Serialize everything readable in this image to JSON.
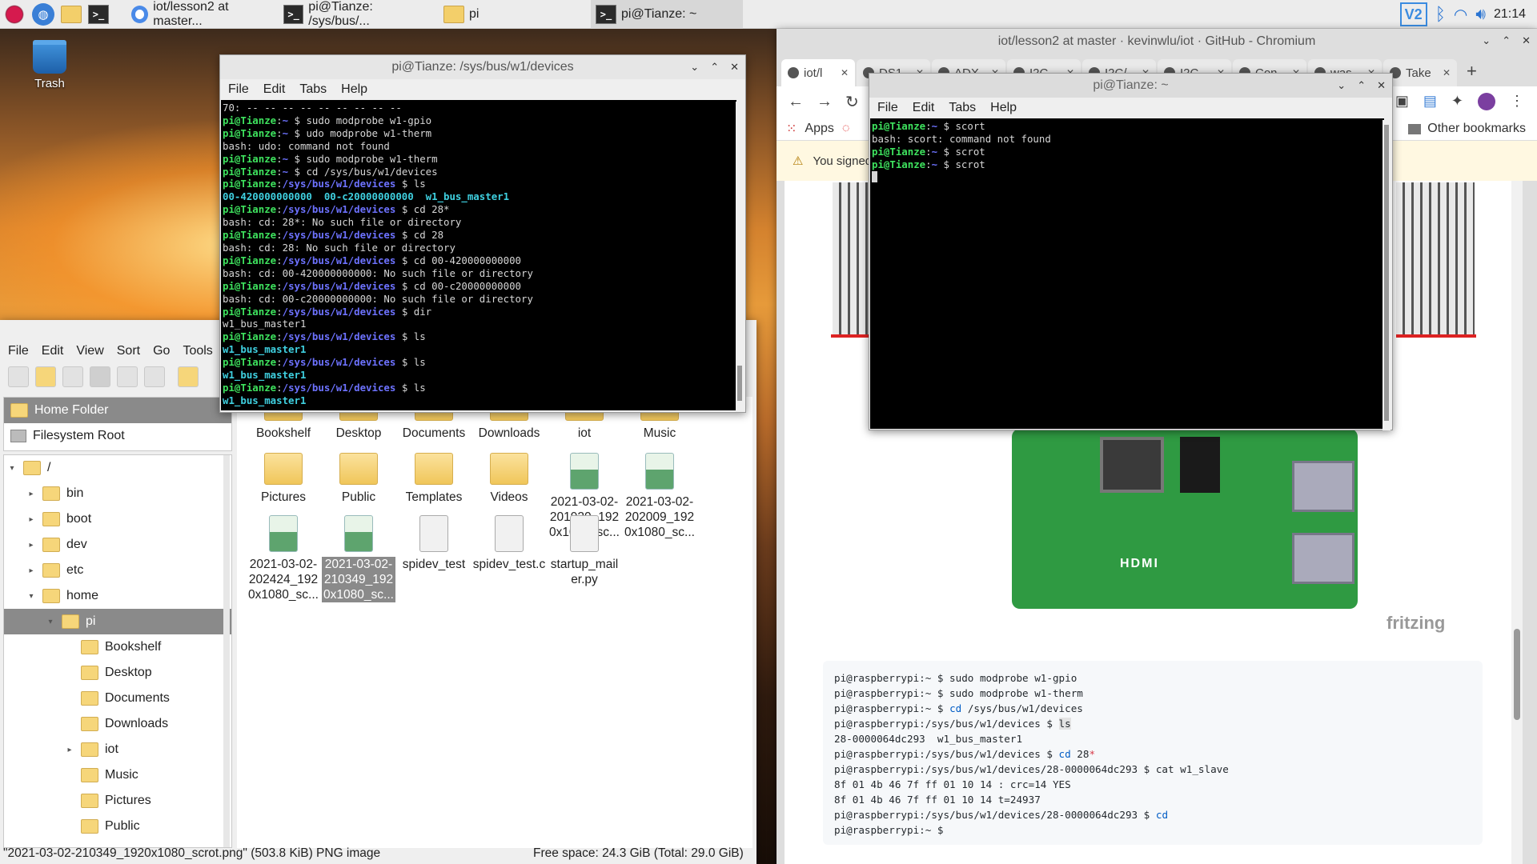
{
  "panel": {
    "tasks": [
      {
        "label": "iot/lesson2 at master..."
      },
      {
        "label": "pi@Tianze: /sys/bus/..."
      },
      {
        "label": "pi"
      },
      {
        "label": "pi@Tianze: ~"
      }
    ],
    "clock": "21:14",
    "vnc_label": "V2"
  },
  "desktop": {
    "trash_label": "Trash"
  },
  "term1": {
    "title": "pi@Tianze: /sys/bus/w1/devices",
    "menu": [
      "File",
      "Edit",
      "Tabs",
      "Help"
    ],
    "lines": [
      [
        [
          "w",
          "70: -- -- -- -- -- -- -- -- --"
        ]
      ],
      [
        [
          "g",
          "pi@Tianze"
        ],
        [
          "w",
          ":"
        ],
        [
          "b",
          "~"
        ],
        [
          "w",
          " $ sudo modprobe w1-gpio"
        ]
      ],
      [
        [
          "g",
          "pi@Tianze"
        ],
        [
          "w",
          ":"
        ],
        [
          "b",
          "~"
        ],
        [
          "w",
          " $ udo modprobe w1-therm"
        ]
      ],
      [
        [
          "w",
          "bash: udo: command not found"
        ]
      ],
      [
        [
          "g",
          "pi@Tianze"
        ],
        [
          "w",
          ":"
        ],
        [
          "b",
          "~"
        ],
        [
          "w",
          " $ sudo modprobe w1-therm"
        ]
      ],
      [
        [
          "g",
          "pi@Tianze"
        ],
        [
          "w",
          ":"
        ],
        [
          "b",
          "~"
        ],
        [
          "w",
          " $ cd /sys/bus/w1/devices"
        ]
      ],
      [
        [
          "g",
          "pi@Tianze"
        ],
        [
          "w",
          ":"
        ],
        [
          "b",
          "/sys/bus/w1/devices"
        ],
        [
          "w",
          " $ ls"
        ]
      ],
      [
        [
          "c",
          "00-420000000000  00-c20000000000  w1_bus_master1"
        ]
      ],
      [
        [
          "g",
          "pi@Tianze"
        ],
        [
          "w",
          ":"
        ],
        [
          "b",
          "/sys/bus/w1/devices"
        ],
        [
          "w",
          " $ cd 28*"
        ]
      ],
      [
        [
          "w",
          "bash: cd: 28*: No such file or directory"
        ]
      ],
      [
        [
          "g",
          "pi@Tianze"
        ],
        [
          "w",
          ":"
        ],
        [
          "b",
          "/sys/bus/w1/devices"
        ],
        [
          "w",
          " $ cd 28"
        ]
      ],
      [
        [
          "w",
          "bash: cd: 28: No such file or directory"
        ]
      ],
      [
        [
          "g",
          "pi@Tianze"
        ],
        [
          "w",
          ":"
        ],
        [
          "b",
          "/sys/bus/w1/devices"
        ],
        [
          "w",
          " $ cd 00-420000000000"
        ]
      ],
      [
        [
          "w",
          "bash: cd: 00-420000000000: No such file or directory"
        ]
      ],
      [
        [
          "g",
          "pi@Tianze"
        ],
        [
          "w",
          ":"
        ],
        [
          "b",
          "/sys/bus/w1/devices"
        ],
        [
          "w",
          " $ cd 00-c20000000000"
        ]
      ],
      [
        [
          "w",
          "bash: cd: 00-c20000000000: No such file or directory"
        ]
      ],
      [
        [
          "g",
          "pi@Tianze"
        ],
        [
          "w",
          ":"
        ],
        [
          "b",
          "/sys/bus/w1/devices"
        ],
        [
          "w",
          " $ dir"
        ]
      ],
      [
        [
          "w",
          "w1_bus_master1"
        ]
      ],
      [
        [
          "g",
          "pi@Tianze"
        ],
        [
          "w",
          ":"
        ],
        [
          "b",
          "/sys/bus/w1/devices"
        ],
        [
          "w",
          " $ ls"
        ]
      ],
      [
        [
          "c",
          "w1_bus_master1"
        ]
      ],
      [
        [
          "g",
          "pi@Tianze"
        ],
        [
          "w",
          ":"
        ],
        [
          "b",
          "/sys/bus/w1/devices"
        ],
        [
          "w",
          " $ ls"
        ]
      ],
      [
        [
          "c",
          "w1_bus_master1"
        ]
      ],
      [
        [
          "g",
          "pi@Tianze"
        ],
        [
          "w",
          ":"
        ],
        [
          "b",
          "/sys/bus/w1/devices"
        ],
        [
          "w",
          " $ ls"
        ]
      ],
      [
        [
          "c",
          "w1_bus_master1"
        ]
      ]
    ]
  },
  "term2": {
    "title": "pi@Tianze: ~",
    "menu": [
      "File",
      "Edit",
      "Tabs",
      "Help"
    ],
    "lines": [
      [
        [
          "g",
          "pi@Tianze"
        ],
        [
          "w",
          ":"
        ],
        [
          "b",
          "~"
        ],
        [
          "w",
          " $ scort"
        ]
      ],
      [
        [
          "w",
          "bash: scort: command not found"
        ]
      ],
      [
        [
          "g",
          "pi@Tianze"
        ],
        [
          "w",
          ":"
        ],
        [
          "b",
          "~"
        ],
        [
          "w",
          " $ scrot"
        ]
      ],
      [
        [
          "g",
          "pi@Tianze"
        ],
        [
          "w",
          ":"
        ],
        [
          "b",
          "~"
        ],
        [
          "w",
          " $ scrot"
        ]
      ]
    ]
  },
  "fm": {
    "menu": [
      "File",
      "Edit",
      "View",
      "Sort",
      "Go",
      "Tools"
    ],
    "places": [
      "Home Folder",
      "Filesystem Root"
    ],
    "tree": [
      {
        "label": "/",
        "level": 0,
        "arrow": "▾"
      },
      {
        "label": "bin",
        "level": 1,
        "arrow": "▸"
      },
      {
        "label": "boot",
        "level": 1,
        "arrow": "▸"
      },
      {
        "label": "dev",
        "level": 1,
        "arrow": "▸"
      },
      {
        "label": "etc",
        "level": 1,
        "arrow": "▸"
      },
      {
        "label": "home",
        "level": 1,
        "arrow": "▾"
      },
      {
        "label": "pi",
        "level": 2,
        "arrow": "▾",
        "selected": true
      },
      {
        "label": "Bookshelf",
        "level": 3,
        "arrow": ""
      },
      {
        "label": "Desktop",
        "level": 3,
        "arrow": ""
      },
      {
        "label": "Documents",
        "level": 3,
        "arrow": ""
      },
      {
        "label": "Downloads",
        "level": 3,
        "arrow": ""
      },
      {
        "label": "iot",
        "level": 3,
        "arrow": "▸"
      },
      {
        "label": "Music",
        "level": 3,
        "arrow": ""
      },
      {
        "label": "Pictures",
        "level": 3,
        "arrow": ""
      },
      {
        "label": "Public",
        "level": 3,
        "arrow": ""
      }
    ],
    "items": [
      {
        "label": "Bookshelf",
        "kind": "fold"
      },
      {
        "label": "Desktop",
        "kind": "fold"
      },
      {
        "label": "Documents",
        "kind": "fold"
      },
      {
        "label": "Downloads",
        "kind": "fold"
      },
      {
        "label": "iot",
        "kind": "fold"
      },
      {
        "label": "Music",
        "kind": "fold"
      },
      {
        "label": "Pictures",
        "kind": "fold"
      },
      {
        "label": "Public",
        "kind": "fold"
      },
      {
        "label": "Templates",
        "kind": "fold"
      },
      {
        "label": "Videos",
        "kind": "fold"
      },
      {
        "label": "2021-03-02-201920_1920x1080_sc...",
        "kind": "img"
      },
      {
        "label": "2021-03-02-202009_1920x1080_sc...",
        "kind": "img"
      },
      {
        "label": "2021-03-02-202424_1920x1080_sc...",
        "kind": "img"
      },
      {
        "label": "2021-03-02-210349_1920x1080_sc...",
        "kind": "img",
        "selected": true
      },
      {
        "label": "spidev_test",
        "kind": "doc"
      },
      {
        "label": "spidev_test.c",
        "kind": "doc"
      },
      {
        "label": "startup_mailer.py",
        "kind": "doc"
      }
    ],
    "status_left": "\"2021-03-02-210349_1920x1080_scrot.png\" (503.8 KiB) PNG image",
    "status_right": "Free space: 24.3 GiB (Total: 29.0 GiB)"
  },
  "chrome": {
    "title": "iot/lesson2 at master · kevinwlu/iot · GitHub - Chromium",
    "tabs": [
      "iot/l",
      "DS1",
      "ADX",
      "I2C",
      "I2C/",
      "I2C",
      "Con",
      "was",
      "Take"
    ],
    "bookmarks": {
      "apps": "Apps",
      "other": "Other bookmarks"
    },
    "infobar": "You signed",
    "fritzing": "fritzing",
    "board_hdmi": "HDMI",
    "code_lines": [
      [
        [
          "n",
          "pi@raspberrypi:~ $ sudo modprobe w1-gpio"
        ]
      ],
      [
        [
          "n",
          "pi@raspberrypi:~ $ sudo modprobe w1-therm"
        ]
      ],
      [
        [
          "n",
          "pi@raspberrypi:~ $ "
        ],
        [
          "k",
          "cd"
        ],
        [
          "n",
          " /sys/bus/w1/devices"
        ]
      ],
      [
        [
          "n",
          "pi@raspberrypi:/sys/bus/w1/devices $ "
        ],
        [
          "h",
          "ls"
        ]
      ],
      [
        [
          "n",
          "28-0000064dc293  w1_bus_master1"
        ]
      ],
      [
        [
          "n",
          "pi@raspberrypi:/sys/bus/w1/devices $ "
        ],
        [
          "k",
          "cd"
        ],
        [
          "n",
          " 28"
        ],
        [
          "s",
          "*"
        ]
      ],
      [
        [
          "n",
          "pi@raspberrypi:/sys/bus/w1/devices/28-0000064dc293 $ cat w1_slave"
        ]
      ],
      [
        [
          "n",
          "8f 01 4b 46 7f ff 01 10 14 : crc=14 YES"
        ]
      ],
      [
        [
          "n",
          "8f 01 4b 46 7f ff 01 10 14 t=24937"
        ]
      ],
      [
        [
          "n",
          "pi@raspberrypi:/sys/bus/w1/devices/28-0000064dc293 $ "
        ],
        [
          "k",
          "cd"
        ]
      ],
      [
        [
          "n",
          "pi@raspberrypi:~ $"
        ]
      ]
    ]
  }
}
